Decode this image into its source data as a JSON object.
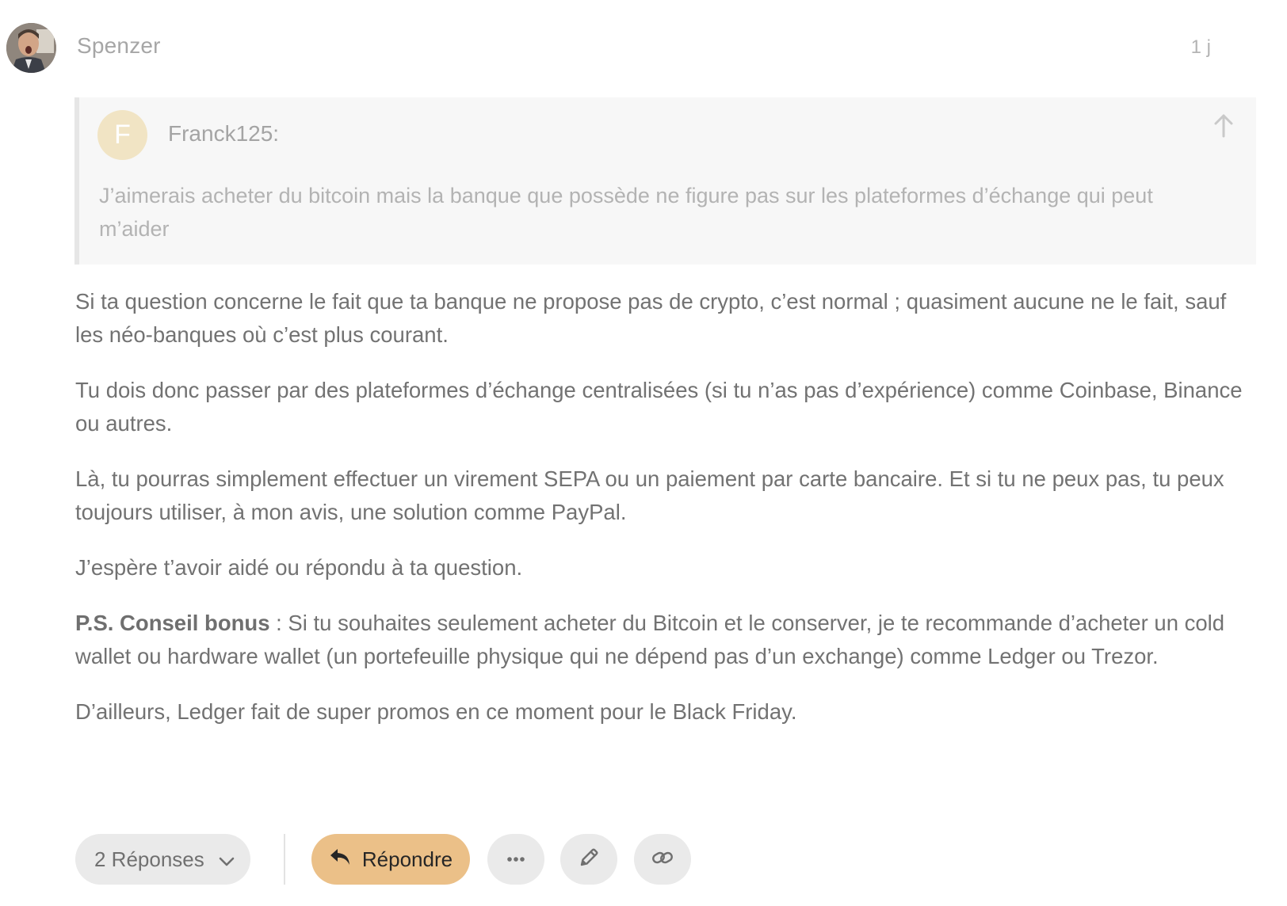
{
  "post": {
    "username": "Spenzer",
    "date": "1 j"
  },
  "quote": {
    "avatar_letter": "F",
    "author": "Franck125:",
    "text": "J’aimerais acheter du bitcoin mais la banque que possède ne figure pas sur les plateformes d’échange qui peut m’aider",
    "icon": "arrow-up-icon"
  },
  "body": {
    "p1": "Si ta question concerne le fait que ta banque ne propose pas de crypto, c’est normal ; quasiment aucune ne le fait, sauf les néo-banques où c’est plus courant.",
    "p2": "Tu dois donc passer par des plateformes d’échange centralisées (si tu n’as pas d’expérience) comme Coinbase, Binance ou autres.",
    "p3": "Là, tu pourras simplement effectuer un virement SEPA ou un paiement par carte bancaire. Et si tu ne peux pas, tu peux toujours utiliser, à mon avis, une solution comme PayPal.",
    "p4": "J’espère t’avoir aidé ou répondu à ta question.",
    "p5_bold": "P.S. Conseil bonus",
    "p5_rest": " : Si tu souhaites seulement acheter du Bitcoin et le conserver, je te recommande d’acheter un cold wallet ou hardware wallet (un portefeuille physique qui ne dépend pas d’un exchange) comme Ledger ou Trezor.",
    "p6": "D’ailleurs, Ledger fait de super promos en ce moment pour le Black Friday."
  },
  "actions": {
    "replies_label": "2 Réponses",
    "reply_label": "Répondre",
    "icons": {
      "replies_toggle": "chevron-down-icon",
      "reply": "reply-icon",
      "more": "ellipsis-icon",
      "edit": "pencil-icon",
      "link": "link-icon"
    }
  },
  "colors": {
    "reply_button": "#ebc088",
    "neutral_button": "#eaeaea",
    "quote_background": "#f7f7f7",
    "quote_avatar": "#f1e4c4"
  }
}
